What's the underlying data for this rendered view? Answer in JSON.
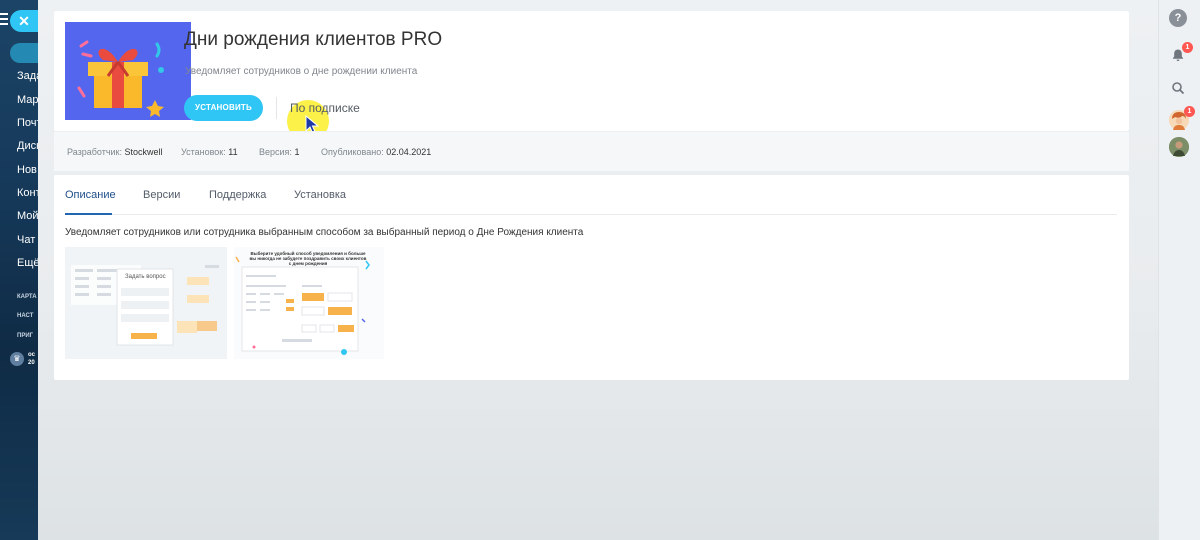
{
  "left_sidebar": {
    "items": [
      "Зада",
      "Мар",
      "Почт",
      "Диск",
      "Нов",
      "Конт",
      "Мой",
      "Чат",
      "Ещё"
    ],
    "small_items": [
      "КАРТА",
      "НАСТ",
      "ПРИГ"
    ],
    "promo": [
      "ос",
      "20"
    ]
  },
  "right_sidebar": {
    "notifications_count": "1",
    "avatar_count": "1"
  },
  "app": {
    "title": "Дни рождения клиентов PRO",
    "description": "Уведомляет сотрудников о дне рождении клиента",
    "install_label": "УСТАНОВИТЬ",
    "subscription_label": "По подписке"
  },
  "meta": {
    "developer_label": "Разработчик:",
    "developer_value": "Stockwell",
    "installs_label": "Установок:",
    "installs_value": "11",
    "version_label": "Версия:",
    "version_value": "1",
    "published_label": "Опубликовано:",
    "published_value": "02.04.2021"
  },
  "tabs": [
    "Описание",
    "Версии",
    "Поддержка",
    "Установка"
  ],
  "active_tab": "Описание",
  "content": {
    "description": "Уведомляет сотрудников или сотрудника выбранным способом за выбранный период о Дне Рождения клиента",
    "screenshot1_caption": "Задать вопрос",
    "screenshot2_caption": "Выберите удобный способ уведомления и больше вы никогда не забудете поздравить своих клиентов с днем рождения"
  },
  "colors": {
    "accent": "#2fc6f6",
    "sidebar": "#16395a",
    "tab_active": "#2067b0",
    "app_icon_bg": "#5a6cf0"
  }
}
